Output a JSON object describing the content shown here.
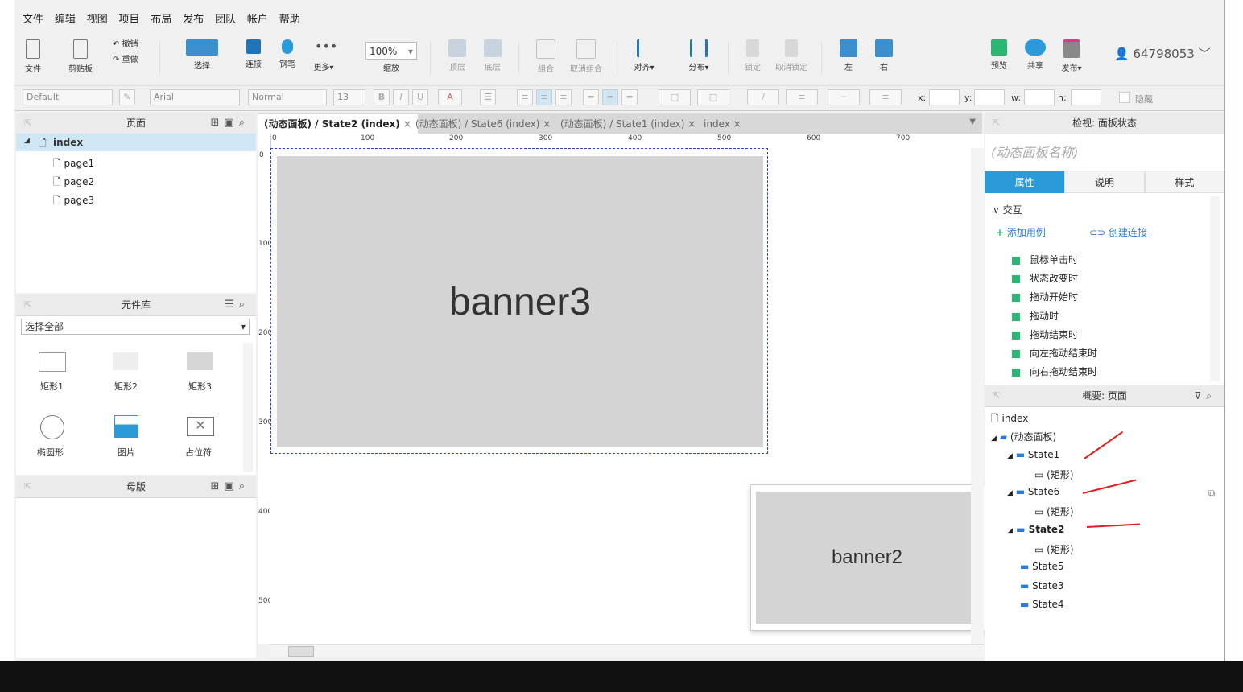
{
  "menu": [
    "文件",
    "编辑",
    "视图",
    "项目",
    "布局",
    "发布",
    "团队",
    "帐户",
    "帮助"
  ],
  "toolbar": {
    "file_label": "文件",
    "clipboard_label": "剪贴板",
    "undo_label": "撤销",
    "redo_label": "重做",
    "select_label": "选择",
    "connect_label": "连接",
    "pen_label": "钢笔",
    "more_label": "更多▾",
    "zoom_value": "100%",
    "zoom_label": "缩放",
    "top_label": "顶层",
    "bottom_label": "底层",
    "group_label": "组合",
    "ungroup_label": "取消组合",
    "align_label": "对齐▾",
    "distribute_label": "分布▾",
    "lock_label": "锁定",
    "unlock_label": "取消锁定",
    "left_label": "左",
    "right_label": "右",
    "preview_label": "预览",
    "share_label": "共享",
    "publish_label": "发布▾",
    "user": "64798053"
  },
  "format": {
    "style": "Default",
    "font": "Arial",
    "weight": "Normal",
    "size": "13",
    "x_label": "x:",
    "y_label": "y:",
    "w_label": "w:",
    "h_label": "h:",
    "hide_label": "隐藏"
  },
  "pages_panel": {
    "title": "页面",
    "root": "index",
    "children": [
      "page1",
      "page2",
      "page3"
    ]
  },
  "library_panel": {
    "title": "元件库",
    "select": "选择全部",
    "widgets": [
      "矩形1",
      "矩形2",
      "矩形3",
      "椭圆形",
      "图片",
      "占位符"
    ]
  },
  "masters_panel": {
    "title": "母版"
  },
  "tabs": [
    "(动态面板) / State2 (index)",
    "(动态面板) / State6 (index)",
    "(动态面板) / State1 (index)",
    "index"
  ],
  "ruler": {
    "h": [
      "0",
      "100",
      "200",
      "300",
      "400",
      "500",
      "600",
      "700"
    ],
    "v": [
      "0",
      "100",
      "200",
      "300",
      "400",
      "500"
    ]
  },
  "canvas": {
    "banner_main": "banner3",
    "banner_preview": "banner2"
  },
  "inspector": {
    "title": "检视: 面板状态",
    "name_placeholder": "(动态面板名称)",
    "tabs": [
      "属性",
      "说明",
      "样式"
    ],
    "section": "交互",
    "add_case": "添加用例",
    "create_link": "创建连接",
    "events": [
      "鼠标单击时",
      "状态改变时",
      "拖动开始时",
      "拖动时",
      "拖动结束时",
      "向左拖动结束时",
      "向右拖动结束时"
    ]
  },
  "outline": {
    "title": "概要: 页面",
    "root": "index",
    "panel": "(动态面板)",
    "states": [
      {
        "name": "State1",
        "child": "(矩形)"
      },
      {
        "name": "State6",
        "child": "(矩形)"
      },
      {
        "name": "State2",
        "child": "(矩形)"
      },
      {
        "name": "State5"
      },
      {
        "name": "State3"
      },
      {
        "name": "State4"
      }
    ]
  },
  "colors": {
    "accent": "#2a9ad8",
    "annotation": "#e02020",
    "banner_fill": "#d4d4d4"
  }
}
